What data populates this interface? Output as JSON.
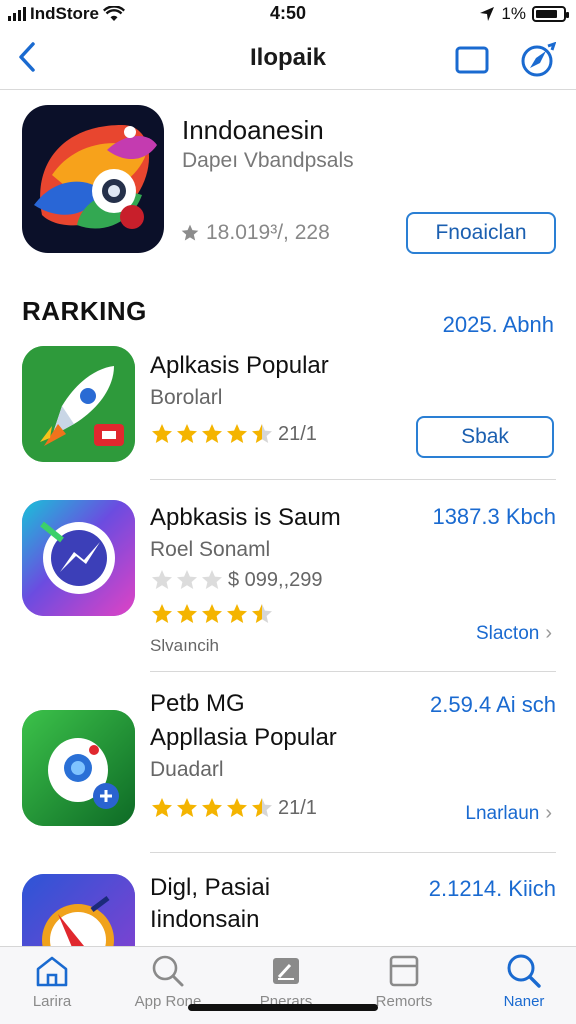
{
  "status_bar": {
    "carrier": "IndStore",
    "time": "4:50",
    "battery": "1%"
  },
  "nav": {
    "title": "Ilopaik",
    "icons": [
      "back-icon",
      "window-icon",
      "compass-icon"
    ]
  },
  "featured": {
    "name": "Inndoanesin",
    "developer": "Dapeı Vbandpsals",
    "rating_text": "18.019³/, 228",
    "button_label": "Fnoaiclan"
  },
  "ranking": {
    "title": "RARKING",
    "link": "2025. Abnh",
    "items": [
      {
        "name": "Aplkasis Popular",
        "subtitle": "Borolarl",
        "rating_text": "21/1",
        "stars": 4.5,
        "button_label": "Sbak",
        "accent": "#2f9b3a"
      },
      {
        "name": "Apbkasis is Saum",
        "subtitle": "Roel Sonaml",
        "meta_rating": "$ 099,,299",
        "rating_text": "",
        "stars": 4.5,
        "extra": "Slvaıncih",
        "price": "1387.3 Kbch",
        "action_label": "Slacton",
        "accent": "#6a4bd6"
      },
      {
        "name": "Petb MG",
        "name2": "Appllasia Popular",
        "subtitle": "Duadarl",
        "rating_text": "21/1",
        "stars": 4.5,
        "price": "2.59.4 Ai sch",
        "action_label": "Lnarlaun",
        "accent": "#1f8c35"
      },
      {
        "name": "Digl, Pasiai",
        "name2": "Iindonsain",
        "price": "2.1214. Kiich",
        "accent": "#3b59c9"
      }
    ]
  },
  "tabbar": {
    "tabs": [
      {
        "label": "Larira",
        "icon": "home-icon"
      },
      {
        "label": "App Rone",
        "icon": "search-icon"
      },
      {
        "label": "Pnerars",
        "icon": "apps-icon"
      },
      {
        "label": "Remorts",
        "icon": "tray-icon"
      },
      {
        "label": "Naner",
        "icon": "search-icon"
      }
    ]
  },
  "colors": {
    "accent": "#1a6ad0",
    "star": "#f4b400",
    "divider": "#d8d8d8"
  }
}
